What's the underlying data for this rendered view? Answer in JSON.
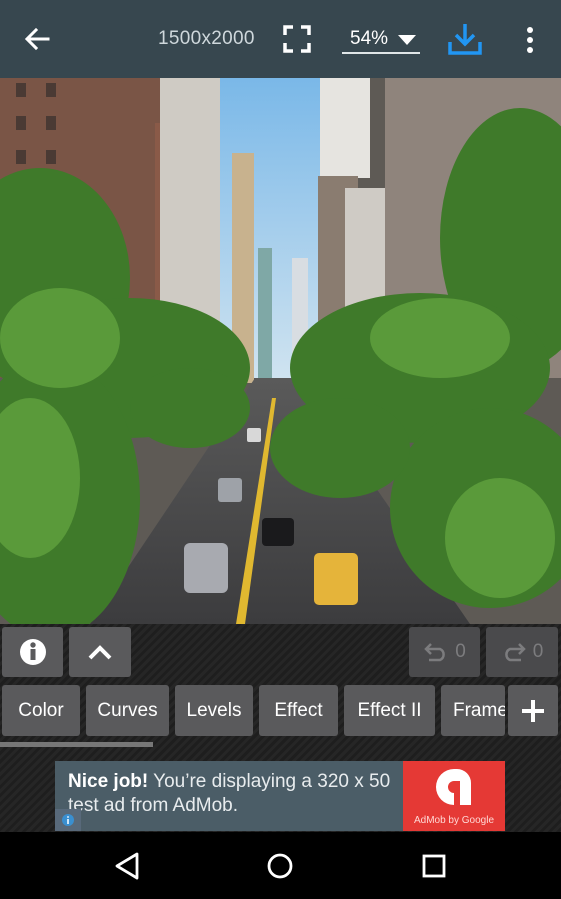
{
  "toolbar": {
    "back_icon": "arrow-left-icon",
    "dimensions": "1500x2000",
    "fit_icon": "fullscreen-icon",
    "zoom_level": "54%",
    "zoom_caret_icon": "dropdown-triangle-icon",
    "save_icon": "download-icon",
    "more_icon": "more-vertical-icon",
    "accent_color": "#2196f3"
  },
  "photo": {
    "description": "Street view of a tree-lined city avenue between tall buildings, with cars and a yellow taxi"
  },
  "actions": {
    "info_icon": "info-circle-icon",
    "collapse_icon": "chevron-up-icon",
    "undo": {
      "icon": "undo-icon",
      "count": "0"
    },
    "redo": {
      "icon": "redo-icon",
      "count": "0"
    }
  },
  "tabs": [
    {
      "label": "Color"
    },
    {
      "label": "Curves"
    },
    {
      "label": "Levels"
    },
    {
      "label": "Effect"
    },
    {
      "label": "Effect II"
    },
    {
      "label": "Frame"
    }
  ],
  "add_icon": "plus-icon",
  "ad": {
    "headline": "Nice job!",
    "body": " You’re displaying a 320 x 50 test ad from AdMob.",
    "brand": "AdMob by Google",
    "info_icon": "ad-info-icon",
    "brand_color": "#e53935"
  },
  "navbar": {
    "back_icon": "nav-back-icon",
    "home_icon": "nav-home-icon",
    "recents_icon": "nav-recents-icon"
  }
}
